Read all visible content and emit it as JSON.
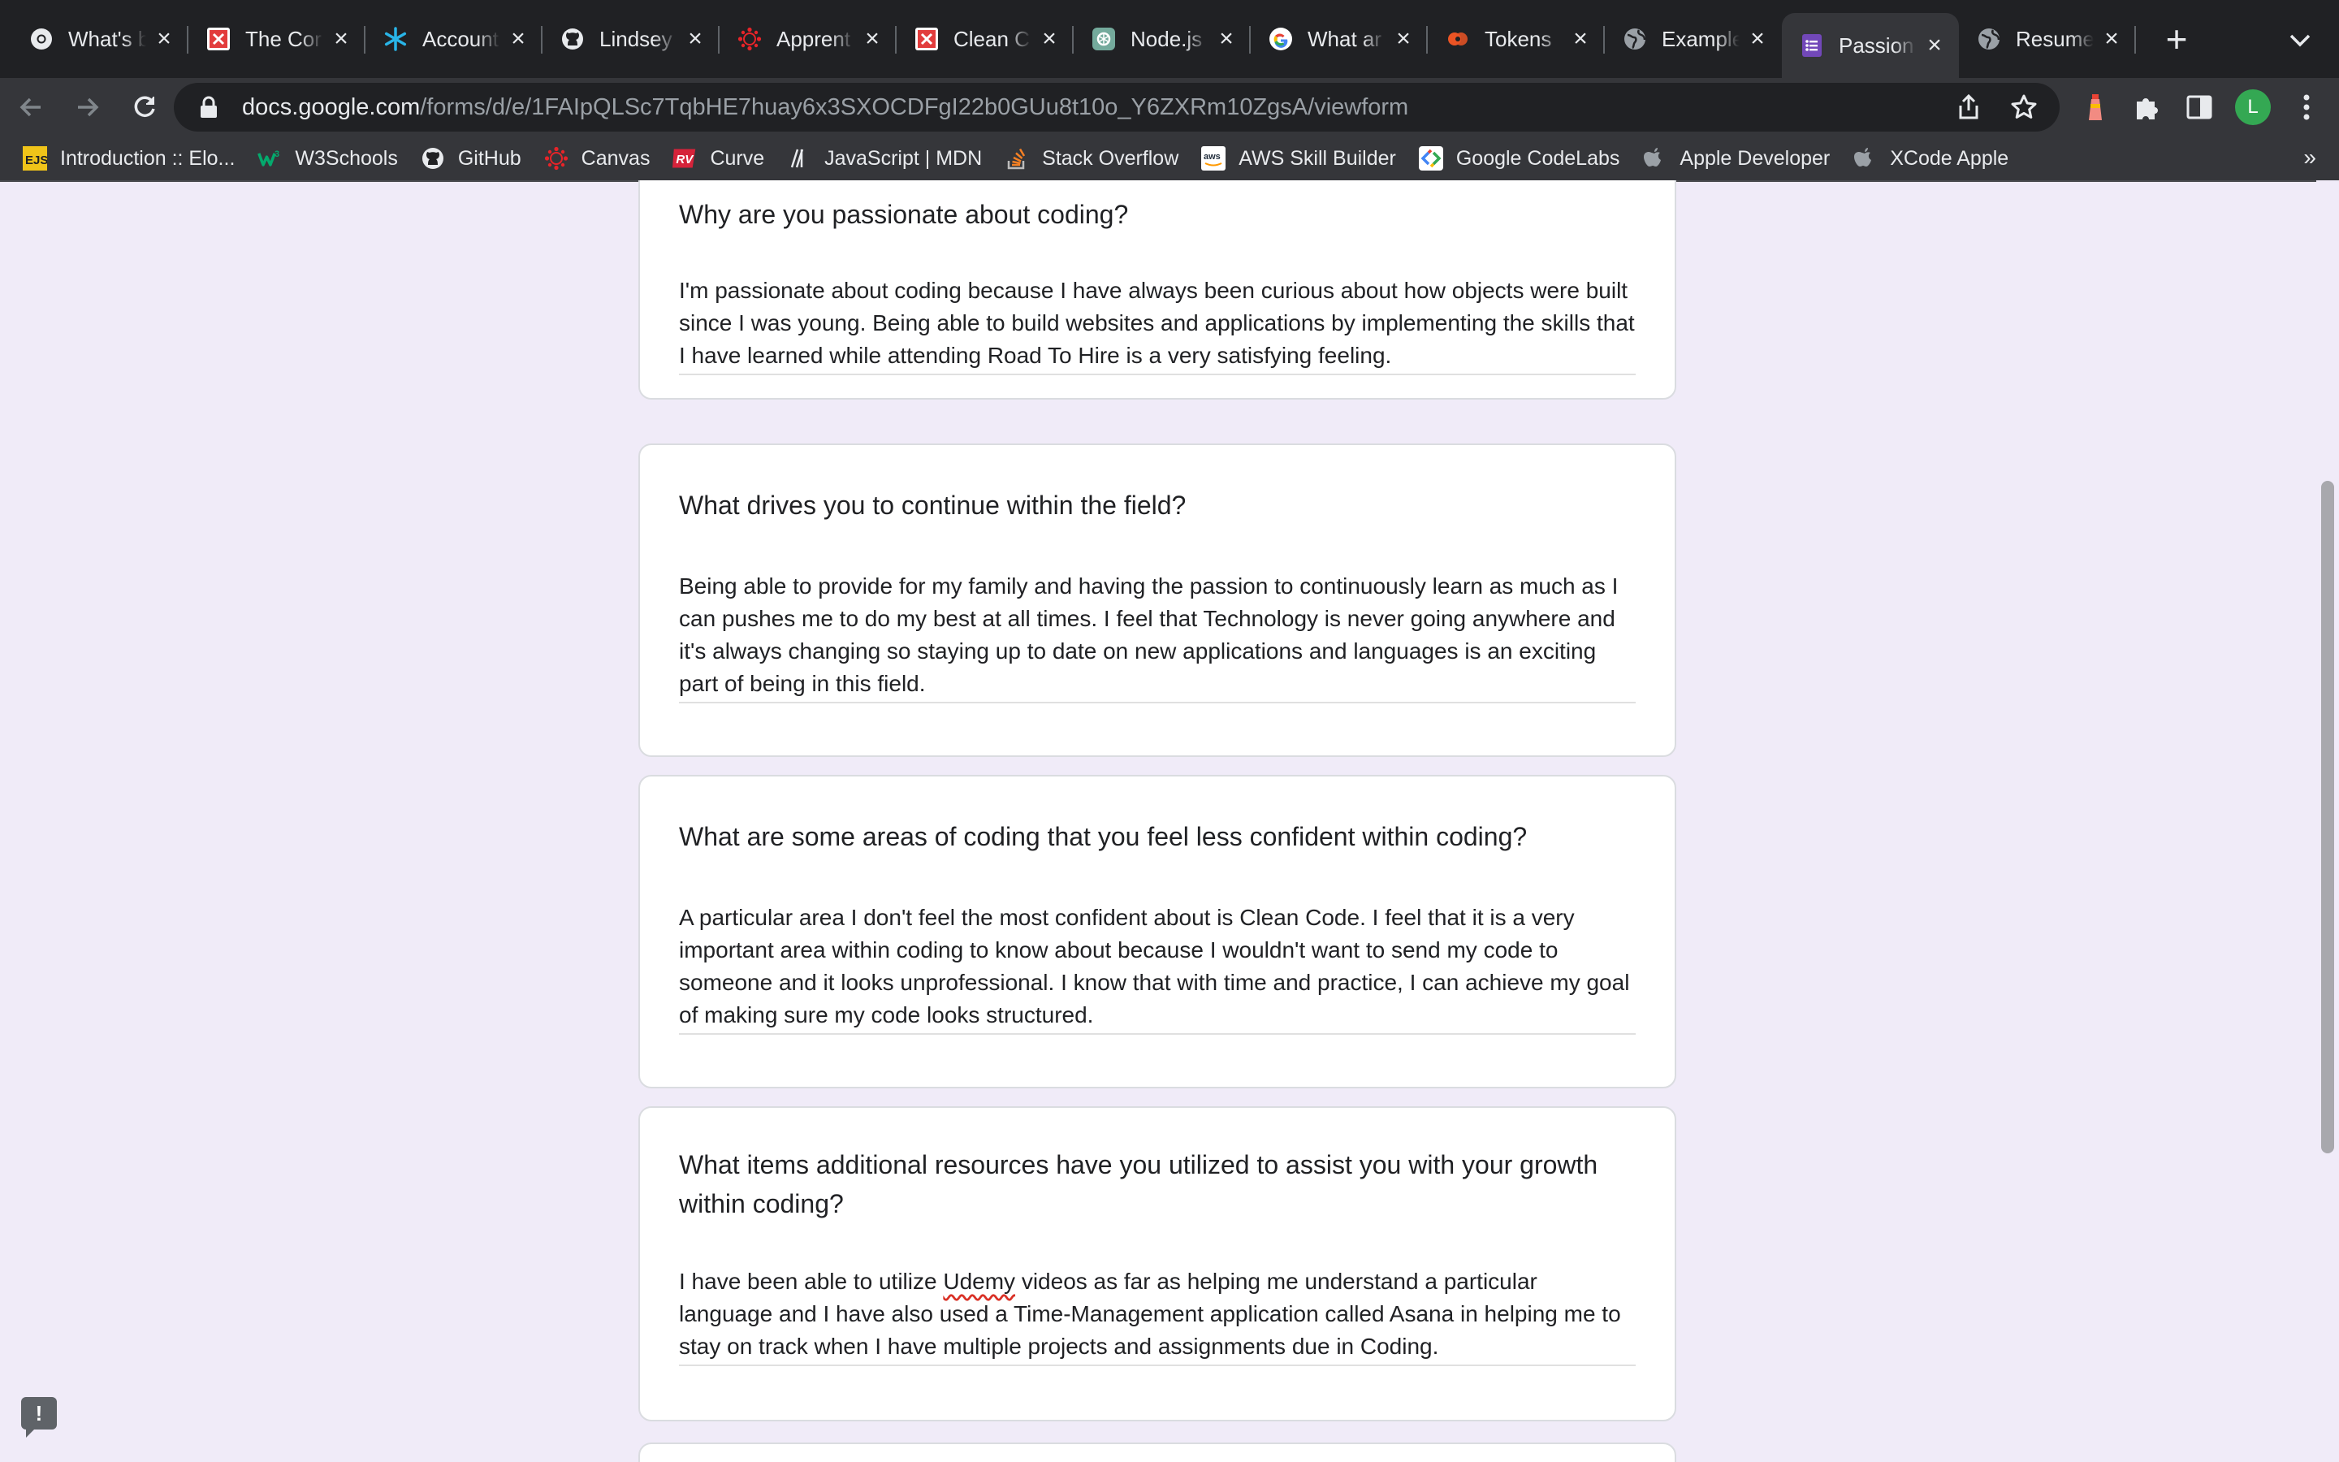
{
  "browser": {
    "tabs": [
      {
        "title": "What's b",
        "icon": "chrome-icon"
      },
      {
        "title": "The Cor",
        "icon": "codecademy-icon"
      },
      {
        "title": "Account",
        "icon": "snowflake-icon"
      },
      {
        "title": "Lindsey",
        "icon": "github-icon"
      },
      {
        "title": "Apprent",
        "icon": "canvas-icon"
      },
      {
        "title": "Clean C",
        "icon": "codecademy-icon"
      },
      {
        "title": "Node.js",
        "icon": "chatgpt-icon"
      },
      {
        "title": "What ar",
        "icon": "google-icon"
      },
      {
        "title": "Tokens",
        "icon": "auth0-icon"
      },
      {
        "title": "Example",
        "icon": "globe-icon"
      },
      {
        "title": "Passion",
        "icon": "forms-icon",
        "active": true
      },
      {
        "title": "Resume",
        "icon": "globe-icon"
      }
    ],
    "url_host": "docs.google.com",
    "url_path": "/forms/d/e/1FAIpQLSc7TqbHE7huay6x3SXOCDFgI22b0GUu8t10o_Y6ZXRm10ZgsA/viewform",
    "profile_initial": "L",
    "bookmarks": [
      {
        "label": "Introduction :: Elo...",
        "icon": "ejs-icon"
      },
      {
        "label": "W3Schools",
        "icon": "w3schools-icon"
      },
      {
        "label": "GitHub",
        "icon": "github-icon"
      },
      {
        "label": "Canvas",
        "icon": "canvas-icon"
      },
      {
        "label": "Curve",
        "icon": "curve-icon"
      },
      {
        "label": "JavaScript | MDN",
        "icon": "mdn-icon"
      },
      {
        "label": "Stack Overflow",
        "icon": "stackoverflow-icon"
      },
      {
        "label": "AWS Skill Builder",
        "icon": "aws-icon"
      },
      {
        "label": "Google CodeLabs",
        "icon": "codelabs-icon"
      },
      {
        "label": "Apple Developer",
        "icon": "apple-icon"
      },
      {
        "label": "XCode Apple",
        "icon": "apple-icon"
      }
    ],
    "bookmarks_more": "»"
  },
  "form": {
    "q1": {
      "question": "Why are you passionate about coding?",
      "answer": "I'm passionate about coding because I have always been curious about how objects were built since I was young. Being able to build websites and applications by implementing the skills that I have learned while attending Road To Hire is a very satisfying feeling."
    },
    "q2": {
      "question": "What drives you to continue within the field?",
      "answer": "Being able to provide for my family and having the passion to continuously learn as much as I can pushes me to do my best at all times. I feel that Technology is never going anywhere and it's always changing so staying up to date on new applications and languages is an exciting part of being in this field."
    },
    "q3": {
      "question": "What are some areas of coding that you feel less confident within coding?",
      "answer": "A particular area I don't feel the most confident about is Clean Code. I feel that it is a very important area within coding to know about because I wouldn't want to send my code to someone and it looks unprofessional. I know that with time and practice, I can achieve my goal of making sure my code looks structured."
    },
    "q4": {
      "question": "What items additional resources have you utilized to assist you with your growth within coding?",
      "answer_before": "I have been able to utilize ",
      "answer_flagged": "Udemy",
      "answer_after": " videos as far as helping me understand a particular language and I have also used a Time-Management application called Asana in helping me to stay on track when I have multiple projects and assignments due in Coding."
    }
  },
  "feedback_icon": "!"
}
